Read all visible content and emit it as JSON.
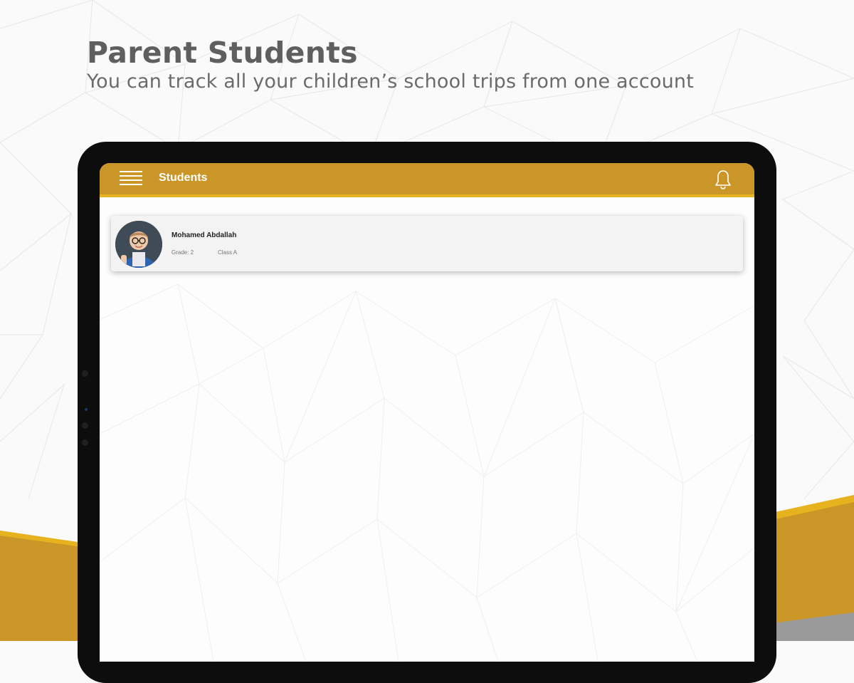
{
  "header": {
    "title": "Parent Students",
    "subtitle": "You can track all your children’s school trips from one account"
  },
  "app": {
    "bar_title": "Students",
    "menu_icon": "hamburger-menu-icon",
    "notification_icon": "bell-icon",
    "accent_color": "#c99627"
  },
  "students": [
    {
      "name": "Mohamed Abdallah",
      "grade": "Grade: 2",
      "class": "Class A"
    }
  ]
}
